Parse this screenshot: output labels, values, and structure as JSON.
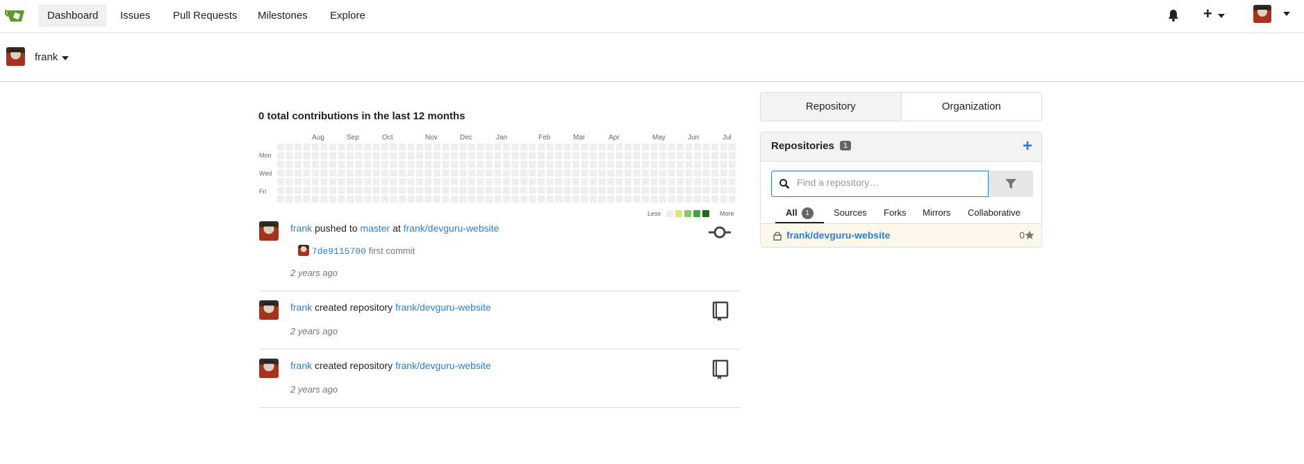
{
  "nav": {
    "logo_icon": "gitea-logo-icon",
    "items": [
      {
        "label": "Dashboard",
        "active": true
      },
      {
        "label": "Issues"
      },
      {
        "label": "Pull Requests"
      },
      {
        "label": "Milestones"
      },
      {
        "label": "Explore"
      }
    ],
    "bell_icon": "bell-icon",
    "plus_icon": "plus-icon",
    "user_avatar_icon": "user-avatar"
  },
  "context": {
    "username": "frank"
  },
  "heatmap": {
    "title": "0 total contributions in the last 12 months",
    "months": [
      "Aug",
      "Sep",
      "Oct",
      "Nov",
      "Dec",
      "Jan",
      "Feb",
      "Mar",
      "Apr",
      "May",
      "Jun",
      "Jul"
    ],
    "days": [
      "Mon",
      "Wed",
      "Fri"
    ],
    "legend_less": "Less",
    "legend_more": "More",
    "colors": [
      "#eeeeee",
      "#d6e685",
      "#8cc665",
      "#44a340",
      "#1e6823"
    ]
  },
  "feed": [
    {
      "user": "frank",
      "action": "pushed to",
      "branch": "master",
      "at": "at",
      "repo": "frank/devguru-website",
      "commit_sha": "7de9115700",
      "commit_msg": "first commit",
      "time": "2 years ago",
      "icon": "commit-icon"
    },
    {
      "user": "frank",
      "action": "created repository",
      "repo": "frank/devguru-website",
      "time": "2 years ago",
      "icon": "repo-book-icon"
    },
    {
      "user": "frank",
      "action": "created repository",
      "repo": "frank/devguru-website",
      "time": "2 years ago",
      "icon": "repo-book-icon"
    }
  ],
  "panel": {
    "tabs": [
      "Repository",
      "Organization"
    ],
    "repos_title": "Repositories",
    "repos_count": "1",
    "search_placeholder": "Find a repository…",
    "filters": [
      "All",
      "Sources",
      "Forks",
      "Mirrors",
      "Collaborative"
    ],
    "all_count": "1",
    "repo_list": [
      {
        "name": "frank/devguru-website",
        "stars": "0",
        "private": true
      }
    ]
  }
}
